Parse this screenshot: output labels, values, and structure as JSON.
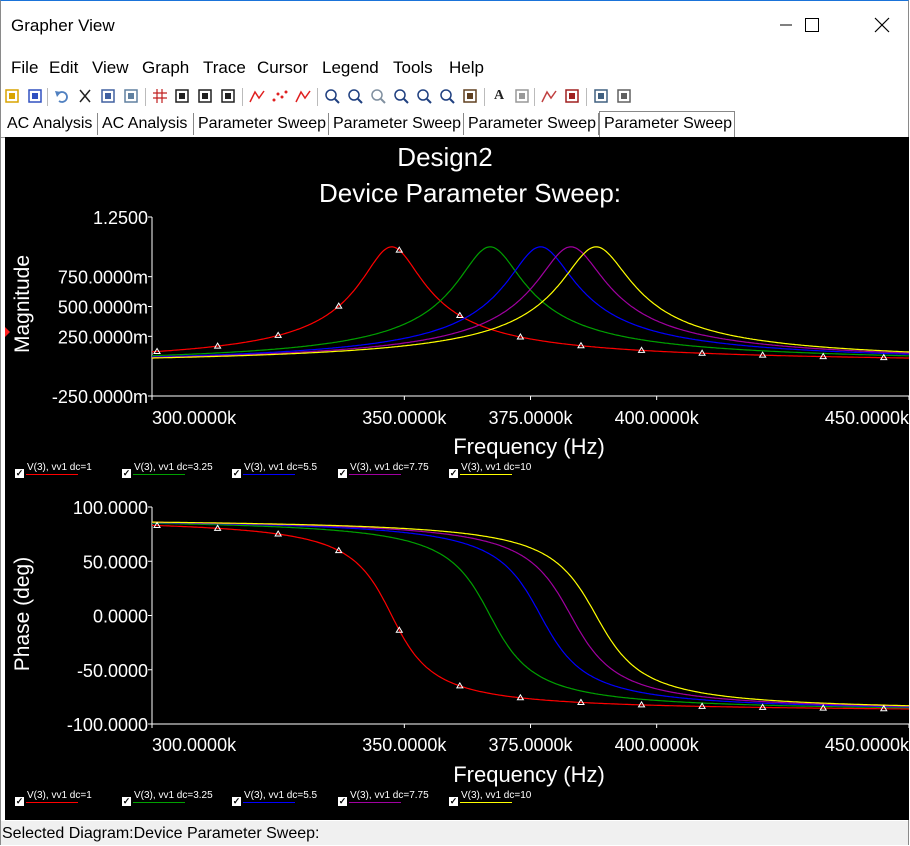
{
  "window": {
    "title": "Grapher View"
  },
  "menu": [
    "File",
    "Edit",
    "View",
    "Graph",
    "Trace",
    "Cursor",
    "Legend",
    "Tools",
    "Help"
  ],
  "toolbar": {
    "icons": [
      "open-icon",
      "save-icon",
      "undo-icon",
      "cut-icon",
      "copy-icon",
      "paste-icon",
      "grid-icon",
      "toggle-icon",
      "chart-icon",
      "reverse-icon",
      "trace-icon",
      "dots-icon",
      "cursor-icon",
      "zoom-in-icon",
      "zoom-out-icon",
      "zoom-full-icon",
      "zoom-area-icon",
      "zoom-x-icon",
      "zoom-y-icon",
      "pan-icon",
      "font-icon",
      "legend-icon",
      "overlay-icon",
      "export-icon",
      "print-icon",
      "properties-icon"
    ],
    "font_glyph": "A"
  },
  "tabs": [
    "AC Analysis",
    "AC Analysis",
    "Parameter Sweep",
    "Parameter Sweep",
    "Parameter Sweep",
    "Parameter Sweep"
  ],
  "active_tab": 5,
  "graph": {
    "title": "Design2",
    "subtitle": "Device Parameter Sweep:"
  },
  "status": "Selected Diagram:Device Parameter Sweep:",
  "chart_data": [
    {
      "type": "line",
      "ylabel": "Magnitude",
      "xlabel": "Frequency (Hz)",
      "yticks": [
        "1.2500",
        "750.0000m",
        "500.0000m",
        "250.0000m",
        "-250.0000m"
      ],
      "ytick_values": [
        1.25,
        0.75,
        0.5,
        0.25,
        -0.25
      ],
      "xticks": [
        "300.0000k",
        "350.0000k",
        "375.0000k",
        "400.0000k",
        "450.0000k"
      ],
      "xtick_values": [
        300000,
        350000,
        375000,
        400000,
        450000
      ],
      "xlim": [
        300000,
        450000
      ],
      "ylim": [
        -0.25,
        1.25
      ],
      "resonance_hz": [
        347500,
        367000,
        377000,
        383000,
        388000
      ],
      "peak": 1.0,
      "grid": false,
      "legend": "bottom"
    },
    {
      "type": "line",
      "ylabel": "Phase (deg)",
      "xlabel": "Frequency (Hz)",
      "yticks": [
        "100.0000",
        "50.0000",
        "0.0000",
        "-50.0000",
        "-100.0000"
      ],
      "ytick_values": [
        100,
        50,
        0,
        -50,
        -100
      ],
      "xticks": [
        "300.0000k",
        "350.0000k",
        "375.0000k",
        "400.0000k",
        "450.0000k"
      ],
      "xtick_values": [
        300000,
        350000,
        375000,
        400000,
        450000
      ],
      "xlim": [
        300000,
        450000
      ],
      "ylim": [
        -100,
        100
      ],
      "phase_range": [
        90,
        -90
      ],
      "grid": false,
      "legend": "bottom"
    }
  ],
  "series": [
    {
      "name": "V(3), vv1 dc=1",
      "color": "#ff0000"
    },
    {
      "name": "V(3), vv1 dc=3.25",
      "color": "#00a000"
    },
    {
      "name": "V(3), vv1 dc=5.5",
      "color": "#0000ff"
    },
    {
      "name": "V(3), vv1 dc=7.75",
      "color": "#a000a0"
    },
    {
      "name": "V(3), vv1 dc=10",
      "color": "#ffff00"
    }
  ]
}
